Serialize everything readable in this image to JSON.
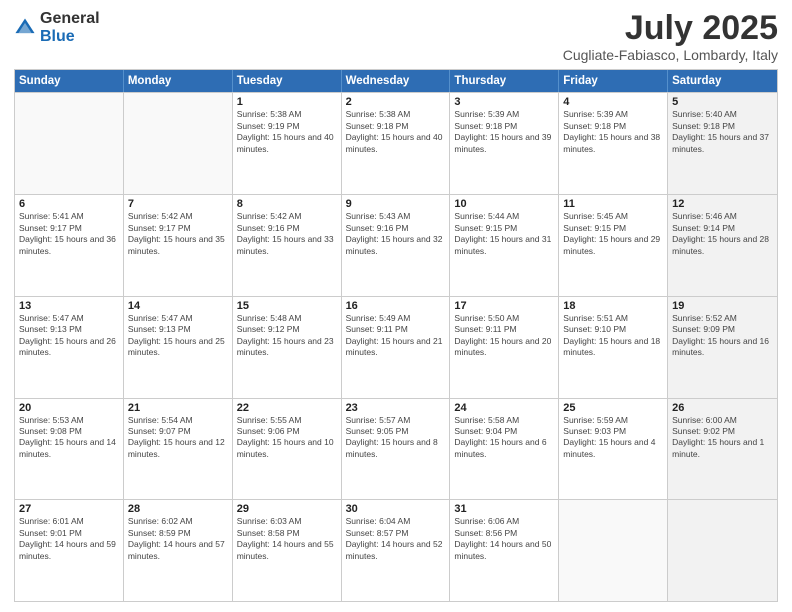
{
  "logo": {
    "general": "General",
    "blue": "Blue"
  },
  "title": "July 2025",
  "location": "Cugliate-Fabiasco, Lombardy, Italy",
  "weekdays": [
    "Sunday",
    "Monday",
    "Tuesday",
    "Wednesday",
    "Thursday",
    "Friday",
    "Saturday"
  ],
  "weeks": [
    [
      {
        "day": "",
        "sunrise": "",
        "sunset": "",
        "daylight": "",
        "shaded": false,
        "empty": true
      },
      {
        "day": "",
        "sunrise": "",
        "sunset": "",
        "daylight": "",
        "shaded": false,
        "empty": true
      },
      {
        "day": "1",
        "sunrise": "Sunrise: 5:38 AM",
        "sunset": "Sunset: 9:19 PM",
        "daylight": "Daylight: 15 hours and 40 minutes.",
        "shaded": false,
        "empty": false
      },
      {
        "day": "2",
        "sunrise": "Sunrise: 5:38 AM",
        "sunset": "Sunset: 9:18 PM",
        "daylight": "Daylight: 15 hours and 40 minutes.",
        "shaded": false,
        "empty": false
      },
      {
        "day": "3",
        "sunrise": "Sunrise: 5:39 AM",
        "sunset": "Sunset: 9:18 PM",
        "daylight": "Daylight: 15 hours and 39 minutes.",
        "shaded": false,
        "empty": false
      },
      {
        "day": "4",
        "sunrise": "Sunrise: 5:39 AM",
        "sunset": "Sunset: 9:18 PM",
        "daylight": "Daylight: 15 hours and 38 minutes.",
        "shaded": false,
        "empty": false
      },
      {
        "day": "5",
        "sunrise": "Sunrise: 5:40 AM",
        "sunset": "Sunset: 9:18 PM",
        "daylight": "Daylight: 15 hours and 37 minutes.",
        "shaded": true,
        "empty": false
      }
    ],
    [
      {
        "day": "6",
        "sunrise": "Sunrise: 5:41 AM",
        "sunset": "Sunset: 9:17 PM",
        "daylight": "Daylight: 15 hours and 36 minutes.",
        "shaded": false,
        "empty": false
      },
      {
        "day": "7",
        "sunrise": "Sunrise: 5:42 AM",
        "sunset": "Sunset: 9:17 PM",
        "daylight": "Daylight: 15 hours and 35 minutes.",
        "shaded": false,
        "empty": false
      },
      {
        "day": "8",
        "sunrise": "Sunrise: 5:42 AM",
        "sunset": "Sunset: 9:16 PM",
        "daylight": "Daylight: 15 hours and 33 minutes.",
        "shaded": false,
        "empty": false
      },
      {
        "day": "9",
        "sunrise": "Sunrise: 5:43 AM",
        "sunset": "Sunset: 9:16 PM",
        "daylight": "Daylight: 15 hours and 32 minutes.",
        "shaded": false,
        "empty": false
      },
      {
        "day": "10",
        "sunrise": "Sunrise: 5:44 AM",
        "sunset": "Sunset: 9:15 PM",
        "daylight": "Daylight: 15 hours and 31 minutes.",
        "shaded": false,
        "empty": false
      },
      {
        "day": "11",
        "sunrise": "Sunrise: 5:45 AM",
        "sunset": "Sunset: 9:15 PM",
        "daylight": "Daylight: 15 hours and 29 minutes.",
        "shaded": false,
        "empty": false
      },
      {
        "day": "12",
        "sunrise": "Sunrise: 5:46 AM",
        "sunset": "Sunset: 9:14 PM",
        "daylight": "Daylight: 15 hours and 28 minutes.",
        "shaded": true,
        "empty": false
      }
    ],
    [
      {
        "day": "13",
        "sunrise": "Sunrise: 5:47 AM",
        "sunset": "Sunset: 9:13 PM",
        "daylight": "Daylight: 15 hours and 26 minutes.",
        "shaded": false,
        "empty": false
      },
      {
        "day": "14",
        "sunrise": "Sunrise: 5:47 AM",
        "sunset": "Sunset: 9:13 PM",
        "daylight": "Daylight: 15 hours and 25 minutes.",
        "shaded": false,
        "empty": false
      },
      {
        "day": "15",
        "sunrise": "Sunrise: 5:48 AM",
        "sunset": "Sunset: 9:12 PM",
        "daylight": "Daylight: 15 hours and 23 minutes.",
        "shaded": false,
        "empty": false
      },
      {
        "day": "16",
        "sunrise": "Sunrise: 5:49 AM",
        "sunset": "Sunset: 9:11 PM",
        "daylight": "Daylight: 15 hours and 21 minutes.",
        "shaded": false,
        "empty": false
      },
      {
        "day": "17",
        "sunrise": "Sunrise: 5:50 AM",
        "sunset": "Sunset: 9:11 PM",
        "daylight": "Daylight: 15 hours and 20 minutes.",
        "shaded": false,
        "empty": false
      },
      {
        "day": "18",
        "sunrise": "Sunrise: 5:51 AM",
        "sunset": "Sunset: 9:10 PM",
        "daylight": "Daylight: 15 hours and 18 minutes.",
        "shaded": false,
        "empty": false
      },
      {
        "day": "19",
        "sunrise": "Sunrise: 5:52 AM",
        "sunset": "Sunset: 9:09 PM",
        "daylight": "Daylight: 15 hours and 16 minutes.",
        "shaded": true,
        "empty": false
      }
    ],
    [
      {
        "day": "20",
        "sunrise": "Sunrise: 5:53 AM",
        "sunset": "Sunset: 9:08 PM",
        "daylight": "Daylight: 15 hours and 14 minutes.",
        "shaded": false,
        "empty": false
      },
      {
        "day": "21",
        "sunrise": "Sunrise: 5:54 AM",
        "sunset": "Sunset: 9:07 PM",
        "daylight": "Daylight: 15 hours and 12 minutes.",
        "shaded": false,
        "empty": false
      },
      {
        "day": "22",
        "sunrise": "Sunrise: 5:55 AM",
        "sunset": "Sunset: 9:06 PM",
        "daylight": "Daylight: 15 hours and 10 minutes.",
        "shaded": false,
        "empty": false
      },
      {
        "day": "23",
        "sunrise": "Sunrise: 5:57 AM",
        "sunset": "Sunset: 9:05 PM",
        "daylight": "Daylight: 15 hours and 8 minutes.",
        "shaded": false,
        "empty": false
      },
      {
        "day": "24",
        "sunrise": "Sunrise: 5:58 AM",
        "sunset": "Sunset: 9:04 PM",
        "daylight": "Daylight: 15 hours and 6 minutes.",
        "shaded": false,
        "empty": false
      },
      {
        "day": "25",
        "sunrise": "Sunrise: 5:59 AM",
        "sunset": "Sunset: 9:03 PM",
        "daylight": "Daylight: 15 hours and 4 minutes.",
        "shaded": false,
        "empty": false
      },
      {
        "day": "26",
        "sunrise": "Sunrise: 6:00 AM",
        "sunset": "Sunset: 9:02 PM",
        "daylight": "Daylight: 15 hours and 1 minute.",
        "shaded": true,
        "empty": false
      }
    ],
    [
      {
        "day": "27",
        "sunrise": "Sunrise: 6:01 AM",
        "sunset": "Sunset: 9:01 PM",
        "daylight": "Daylight: 14 hours and 59 minutes.",
        "shaded": false,
        "empty": false
      },
      {
        "day": "28",
        "sunrise": "Sunrise: 6:02 AM",
        "sunset": "Sunset: 8:59 PM",
        "daylight": "Daylight: 14 hours and 57 minutes.",
        "shaded": false,
        "empty": false
      },
      {
        "day": "29",
        "sunrise": "Sunrise: 6:03 AM",
        "sunset": "Sunset: 8:58 PM",
        "daylight": "Daylight: 14 hours and 55 minutes.",
        "shaded": false,
        "empty": false
      },
      {
        "day": "30",
        "sunrise": "Sunrise: 6:04 AM",
        "sunset": "Sunset: 8:57 PM",
        "daylight": "Daylight: 14 hours and 52 minutes.",
        "shaded": false,
        "empty": false
      },
      {
        "day": "31",
        "sunrise": "Sunrise: 6:06 AM",
        "sunset": "Sunset: 8:56 PM",
        "daylight": "Daylight: 14 hours and 50 minutes.",
        "shaded": false,
        "empty": false
      },
      {
        "day": "",
        "sunrise": "",
        "sunset": "",
        "daylight": "",
        "shaded": false,
        "empty": true
      },
      {
        "day": "",
        "sunrise": "",
        "sunset": "",
        "daylight": "",
        "shaded": true,
        "empty": true
      }
    ]
  ]
}
